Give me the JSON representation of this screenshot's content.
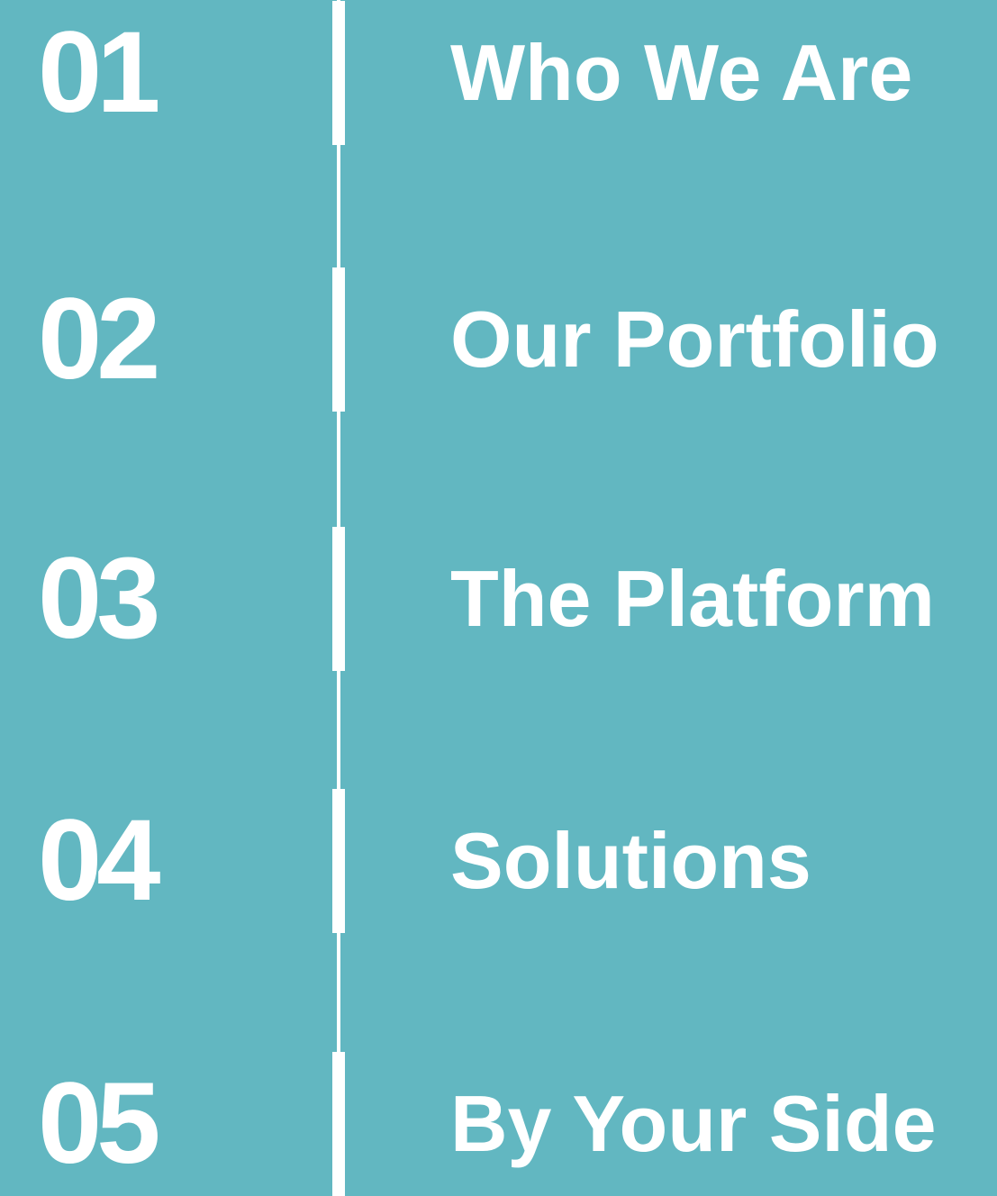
{
  "colors": {
    "background": "#62b7c1",
    "foreground": "#ffffff"
  },
  "menu": {
    "items": [
      {
        "number": "01",
        "label": "Who We Are"
      },
      {
        "number": "02",
        "label": "Our Portfolio"
      },
      {
        "number": "03",
        "label": "The Platform"
      },
      {
        "number": "04",
        "label": "Solutions"
      },
      {
        "number": "05",
        "label": "By Your Side"
      }
    ]
  }
}
